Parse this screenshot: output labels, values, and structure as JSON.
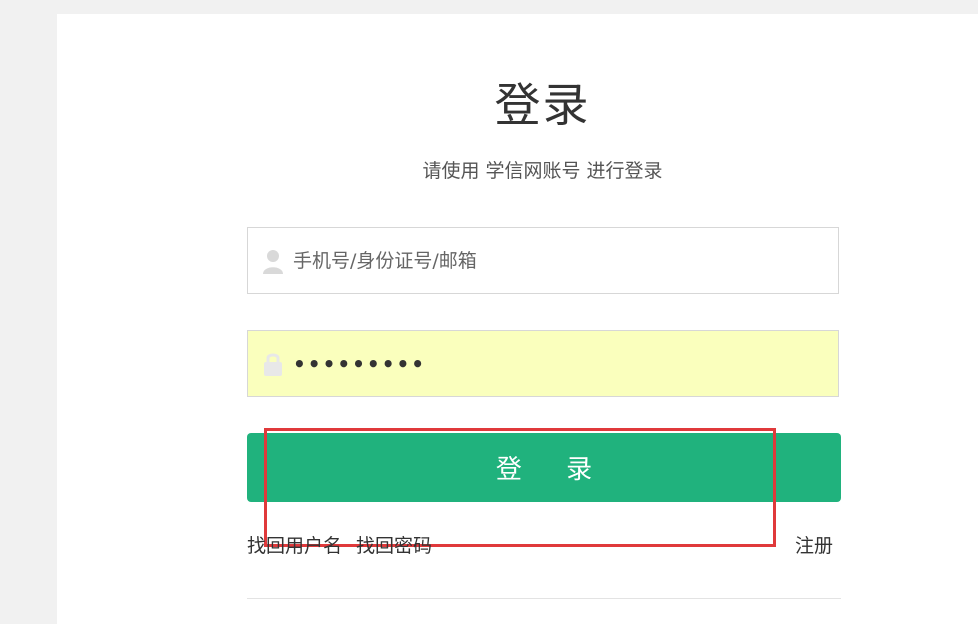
{
  "login": {
    "title": "登录",
    "subtitle": "请使用 学信网账号 进行登录",
    "username_placeholder": "手机号/身份证号/邮箱",
    "username_value": "",
    "password_value": "•••••••••",
    "login_button": "登 录",
    "forgot_username": "找回用户名",
    "forgot_password": "找回密码",
    "register": "注册"
  },
  "colors": {
    "primary": "#20b27d",
    "autofill": "#faffbd",
    "highlight": "#e0393b"
  },
  "icons": {
    "username": "user-icon",
    "password": "lock-icon"
  }
}
